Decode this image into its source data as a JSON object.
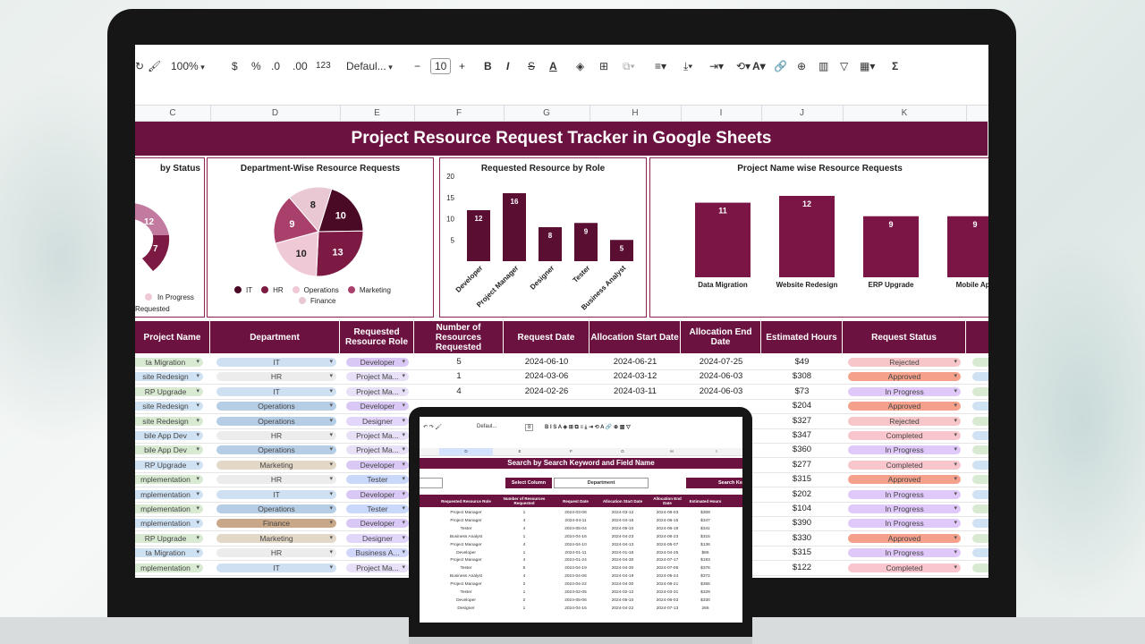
{
  "toolbar": {
    "zoom": "100%",
    "currency": "$",
    "percent": "%",
    "dec_less": ".0",
    "dec_more": ".00",
    "number_format": "123",
    "font": "Defaul...",
    "font_size": "10",
    "minus": "−",
    "plus": "+",
    "bold": "B",
    "italic": "I",
    "strike": "S",
    "text_color": "A",
    "sum": "Σ"
  },
  "columns": [
    "C",
    "D",
    "E",
    "F",
    "G",
    "H",
    "I",
    "J",
    "K"
  ],
  "title": "Project Resource Request Tracker in Google Sheets",
  "charts": {
    "status": {
      "title": "by Status",
      "labels": [
        "12",
        "7"
      ],
      "legend": [
        "In Progress",
        "Requested"
      ]
    },
    "department": {
      "title": "Department-Wise Resource Requests",
      "legend": [
        "IT",
        "HR",
        "Operations",
        "Marketing",
        "Finance"
      ]
    },
    "role": {
      "title": "Requested Resource  by Role",
      "yticks": [
        "20",
        "15",
        "10",
        "5"
      ]
    },
    "project": {
      "title": "Project Name wise Resource Requests"
    }
  },
  "chart_data": [
    {
      "type": "pie",
      "title": "Department-Wise Resource Requests",
      "categories": [
        "IT",
        "HR",
        "Operations",
        "Marketing",
        "Finance"
      ],
      "values": [
        10,
        13,
        10,
        9,
        8
      ],
      "colors": [
        "#4a0a26",
        "#7d1a44",
        "#f0c9d6",
        "#a9406c",
        "#e9c7d3"
      ]
    },
    {
      "type": "bar",
      "title": "Requested Resource  by Role",
      "categories": [
        "Developer",
        "Project Manager",
        "Designer",
        "Tester",
        "Business Analyst"
      ],
      "values": [
        12,
        16,
        8,
        9,
        5
      ],
      "ylim": [
        0,
        20
      ]
    },
    {
      "type": "bar",
      "title": "Project Name wise Resource Requests",
      "categories": [
        "Data Migration",
        "Website Redesign",
        "ERP Upgrade",
        "Mobile App"
      ],
      "values": [
        11,
        12,
        9,
        9
      ]
    }
  ],
  "table": {
    "headers": [
      "Project Name",
      "Department",
      "Requested Resource Role",
      "Number of Resources Requested",
      "Request Date",
      "Allocation Start Date",
      "Allocation End Date",
      "Estimated Hours",
      "Request Status"
    ],
    "rows": [
      {
        "project": "ta Migration",
        "dept": "IT",
        "role": "Developer",
        "num": "5",
        "req": "2024-06-10",
        "start": "2024-06-21",
        "end": "2024-07-25",
        "hours": "$49",
        "status": "Rejected"
      },
      {
        "project": "site Redesign",
        "dept": "HR",
        "role": "Project Ma...",
        "num": "1",
        "req": "2024-03-06",
        "start": "2024-03-12",
        "end": "2024-06-03",
        "hours": "$308",
        "status": "Approved"
      },
      {
        "project": "RP Upgrade",
        "dept": "IT",
        "role": "Project Ma...",
        "num": "4",
        "req": "2024-02-26",
        "start": "2024-03-11",
        "end": "2024-06-03",
        "hours": "$73",
        "status": "In Progress"
      },
      {
        "project": "site Redesign",
        "dept": "Operations",
        "role": "Developer",
        "num": "",
        "req": "",
        "start": "",
        "end": "",
        "hours": "$204",
        "status": "Approved"
      },
      {
        "project": "site Redesign",
        "dept": "Operations",
        "role": "Designer",
        "num": "",
        "req": "",
        "start": "",
        "end": "",
        "hours": "$327",
        "status": "Rejected"
      },
      {
        "project": "bile App Dev",
        "dept": "HR",
        "role": "Project Ma...",
        "num": "",
        "req": "",
        "start": "",
        "end": "",
        "hours": "$347",
        "status": "Completed"
      },
      {
        "project": "bile App Dev",
        "dept": "Operations",
        "role": "Project Ma...",
        "num": "",
        "req": "",
        "start": "",
        "end": "",
        "hours": "$360",
        "status": "In Progress"
      },
      {
        "project": "RP Upgrade",
        "dept": "Marketing",
        "role": "Developer",
        "num": "",
        "req": "",
        "start": "",
        "end": "",
        "hours": "$277",
        "status": "Completed"
      },
      {
        "project": "mplementation",
        "dept": "HR",
        "role": "Tester",
        "num": "",
        "req": "",
        "start": "",
        "end": "",
        "hours": "$315",
        "status": "Approved"
      },
      {
        "project": "mplementation",
        "dept": "IT",
        "role": "Developer",
        "num": "",
        "req": "",
        "start": "",
        "end": "",
        "hours": "$202",
        "status": "In Progress"
      },
      {
        "project": "mplementation",
        "dept": "Operations",
        "role": "Tester",
        "num": "",
        "req": "",
        "start": "",
        "end": "",
        "hours": "$104",
        "status": "In Progress"
      },
      {
        "project": "mplementation",
        "dept": "Finance",
        "role": "Developer",
        "num": "",
        "req": "",
        "start": "",
        "end": "",
        "hours": "$390",
        "status": "In Progress"
      },
      {
        "project": "RP Upgrade",
        "dept": "Marketing",
        "role": "Designer",
        "num": "",
        "req": "",
        "start": "",
        "end": "",
        "hours": "$330",
        "status": "Approved"
      },
      {
        "project": "ta Migration",
        "dept": "HR",
        "role": "Business A...",
        "num": "",
        "req": "",
        "start": "",
        "end": "",
        "hours": "$315",
        "status": "In Progress"
      },
      {
        "project": "mplementation",
        "dept": "IT",
        "role": "Project Ma...",
        "num": "",
        "req": "",
        "start": "",
        "end": "",
        "hours": "$122",
        "status": "Completed"
      }
    ]
  },
  "mini": {
    "font": "Defaul...",
    "font_size": "8",
    "columns": [
      "D",
      "E",
      "F",
      "G",
      "H",
      "I"
    ],
    "title": "Search by Search Keyword and Field Name",
    "select_label": "Select Column",
    "select_value": "Department",
    "search_label": "Search Ke",
    "headers": [
      "Requested Resource Role",
      "Number of Resources Requested",
      "Request Date",
      "Allocation Start Date",
      "Allocation End Date",
      "Estimated Hours"
    ],
    "rows": [
      [
        "Project Manager",
        "1",
        "2024-03-06",
        "2024-03-12",
        "2024-06-03",
        "$308"
      ],
      [
        "Project Manager",
        "4",
        "2024-04-11",
        "2024-04-16",
        "2024-06-15",
        "$347"
      ],
      [
        "Tester",
        "4",
        "2024-05-04",
        "2024-05-10",
        "2024-06-18",
        "$341"
      ],
      [
        "Business Analyst",
        "1",
        "2024-04-16",
        "2024-04-23",
        "2024-06-23",
        "$315"
      ],
      [
        "Project Manager",
        "4",
        "2024-04-10",
        "2024-04-13",
        "2024-05-07",
        "$136"
      ],
      [
        "Developer",
        "1",
        "2024-01-11",
        "2024-01-16",
        "2024-04-25",
        "$86"
      ],
      [
        "Project Manager",
        "4",
        "2024-01-24",
        "2024-04-30",
        "2024-07-17",
        "$193"
      ],
      [
        "Tester",
        "5",
        "2024-04-19",
        "2024-04-30",
        "2024-07-06",
        "$376"
      ],
      [
        "Business Analyst",
        "4",
        "2024-04-06",
        "2024-04-19",
        "2024-05-24",
        "$372"
      ],
      [
        "Project Manager",
        "2",
        "2024-04-22",
        "2024-04-30",
        "2024-06-21",
        "$355"
      ],
      [
        "Tester",
        "1",
        "2024-02-05",
        "2024-02-12",
        "2024-03-31",
        "$329"
      ],
      [
        "Developer",
        "2",
        "2024-05-06",
        "2024-05-10",
        "2024-06-03",
        "$330"
      ],
      [
        "Designer",
        "1",
        "2024-04-15",
        "2024-04-22",
        "2024-07-13",
        "266"
      ]
    ]
  },
  "colors": {
    "accent": "#6c1240"
  }
}
